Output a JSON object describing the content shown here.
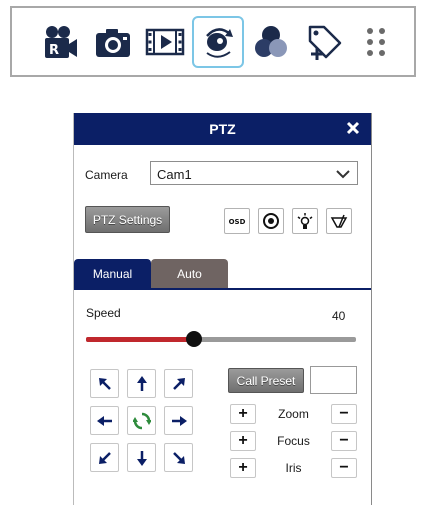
{
  "colors": {
    "title_bar": "#0b1f66",
    "tab_inactive": "#6f6462",
    "slider_fill": "#c0282d",
    "toolbar_icon": "#1b2a4a",
    "active_outline": "#7cc6e6",
    "green_refresh": "#2e8b3c"
  },
  "toolbar": {
    "items": [
      {
        "icon": "recording-camera-icon",
        "active": false
      },
      {
        "icon": "camera-snapshot-icon",
        "active": false
      },
      {
        "icon": "video-playback-icon",
        "active": false
      },
      {
        "icon": "ptz-control-icon",
        "active": true
      },
      {
        "icon": "color-adjust-icon",
        "active": false
      },
      {
        "icon": "add-tag-icon",
        "active": false
      },
      {
        "icon": "more-grid-icon",
        "active": false
      }
    ]
  },
  "ptz_panel": {
    "title": "PTZ",
    "close_icon": "close-icon",
    "camera_label": "Camera",
    "camera_selected": "Cam1",
    "ptz_settings_label": "PTZ Settings",
    "icon_buttons": [
      "osd-icon",
      "focus-target-icon",
      "light-icon",
      "wiper-icon"
    ],
    "osd_text": "OSD",
    "tabs": [
      {
        "label": "Manual",
        "active": true
      },
      {
        "label": "Auto",
        "active": false
      }
    ],
    "speed_label": "Speed",
    "speed_value": "40",
    "speed_fraction": 0.4,
    "call_preset_label": "Call Preset",
    "preset_value": "",
    "controls": [
      {
        "label": "Zoom",
        "plus": "+",
        "minus": "−"
      },
      {
        "label": "Focus",
        "plus": "+",
        "minus": "−"
      },
      {
        "label": "Iris",
        "plus": "+",
        "minus": "−"
      }
    ]
  }
}
